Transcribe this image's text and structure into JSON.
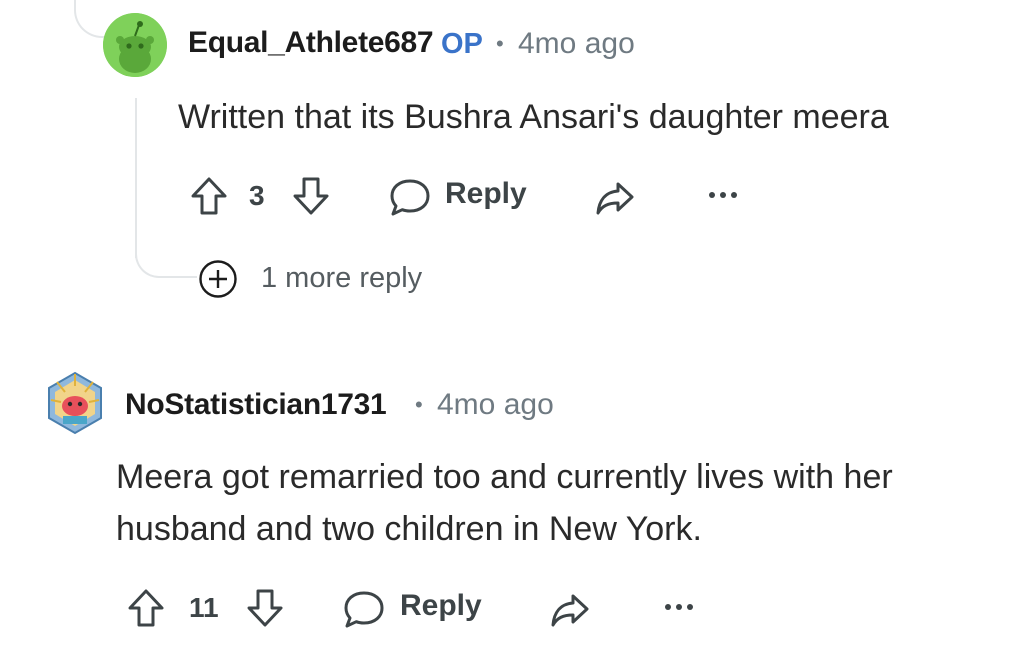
{
  "comments": [
    {
      "username": "Equal_Athlete687",
      "op_badge": "OP",
      "separator": "•",
      "time": "4mo ago",
      "body_lines": [
        "Written that its Bushra Ansari's daughter meera"
      ],
      "votes": "3",
      "reply_label": "Reply",
      "avatar_color": "#7fd15a",
      "more_replies": "1 more reply"
    },
    {
      "username": "NoStatistician1731",
      "separator": "•",
      "time": "4mo ago",
      "body_lines": [
        "Meera got remarried too and currently lives with her",
        "husband and two children in New York."
      ],
      "votes": "11",
      "reply_label": "Reply"
    }
  ],
  "icons": {
    "upvote": "upvote-arrow-icon",
    "downvote": "downvote-arrow-icon",
    "reply": "speech-bubble-icon",
    "share": "share-arrow-icon",
    "more": "ellipsis-icon",
    "expand": "plus-circle-icon"
  },
  "colors": {
    "op": "#3a73c9",
    "text": "#1c1c1c",
    "muted": "#6f7a82",
    "thread": "#e3e6e8"
  }
}
